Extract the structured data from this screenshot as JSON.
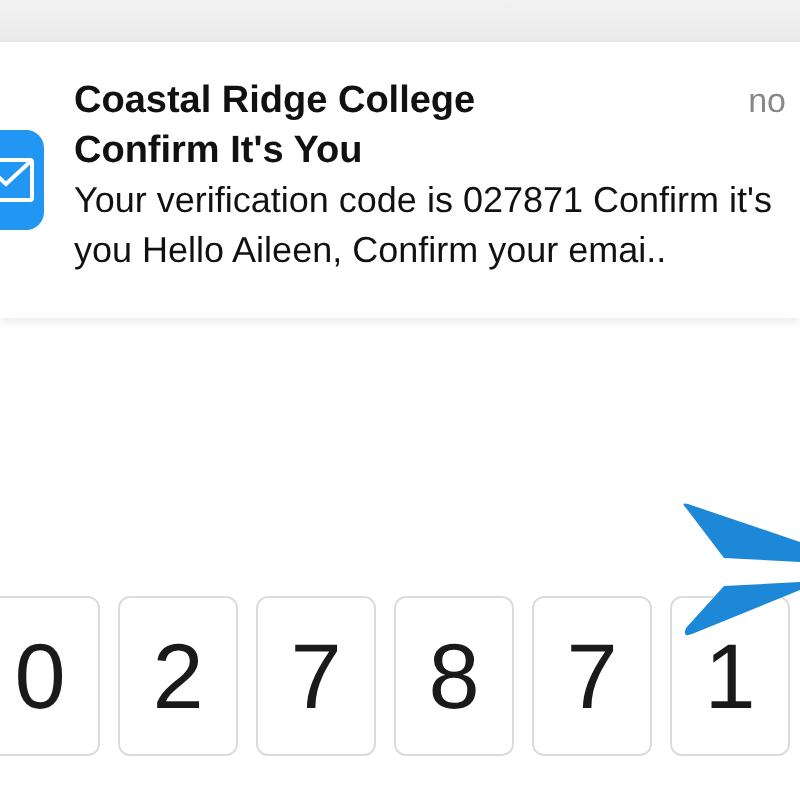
{
  "notification": {
    "sender": "Coastal Ridge College",
    "time": "no",
    "subject": "Confirm It's You",
    "preview": "Your verification code is 027871 Confirm it's you Hello Aileen, Confirm your emai.."
  },
  "code_digits": [
    "0",
    "2",
    "7",
    "8",
    "7",
    "1"
  ]
}
